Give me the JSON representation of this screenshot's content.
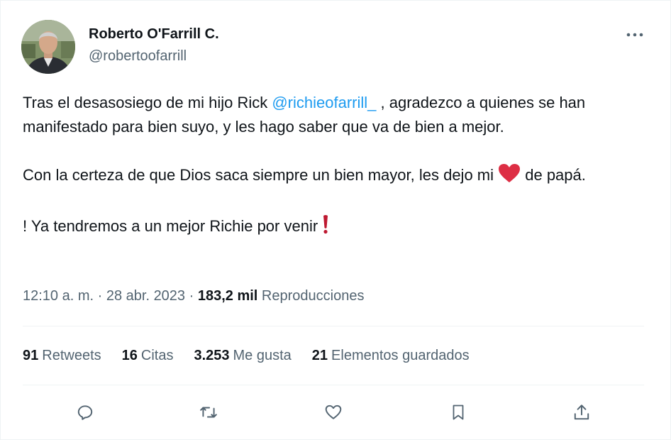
{
  "author": {
    "name": "Roberto O'Farrill C.",
    "handle": "@robertoofarrill"
  },
  "tweet": {
    "p1_a": "Tras el desasosiego de mi hijo Rick ",
    "p1_mention": "@richieofarrill_",
    "p1_b": " , agradezco a quienes se han manifestado para bien suyo, y les hago saber que va de bien a mejor.",
    "p2_a": "Con la certeza de que Dios saca siempre un bien mayor, les dejo mi ",
    "p2_b": " de papá.",
    "p3": "! Ya tendremos a un mejor Richie por venir "
  },
  "meta": {
    "time": "12:10 a. m.",
    "sep1": " · ",
    "date": "28 abr. 2023",
    "sep2": " · ",
    "views": "183,2 mil",
    "views_label": " Reproducciones"
  },
  "stats": {
    "retweets": {
      "num": "91",
      "label": "Retweets"
    },
    "quotes": {
      "num": "16",
      "label": "Citas"
    },
    "likes": {
      "num": "3.253",
      "label": "Me gusta"
    },
    "bookmarks": {
      "num": "21",
      "label": "Elementos guardados"
    }
  },
  "colors": {
    "accent": "#1d9bf0",
    "secondary_text": "#536471",
    "heart_emoji": "#dd2e44",
    "icon": "#536471"
  },
  "icons": {
    "more": "more-horizontal-icon",
    "reply": "reply-icon",
    "retweet": "retweet-icon",
    "like": "heart-icon",
    "bookmark": "bookmark-icon",
    "share": "share-icon"
  }
}
